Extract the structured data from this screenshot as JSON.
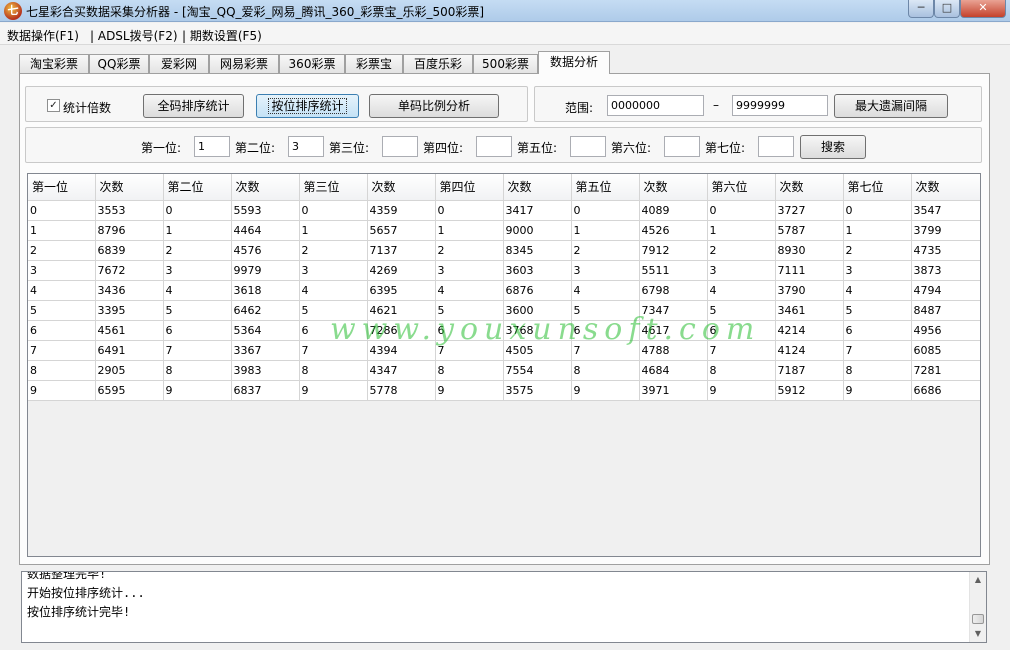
{
  "window": {
    "title": "七星彩合买数据采集分析器 - [淘宝_QQ_爱彩_网易_腾讯_360_彩票宝_乐彩_500彩票]",
    "min_glyph": "─",
    "max_glyph": "□",
    "close_glyph": "✕"
  },
  "menu": [
    {
      "label": "数据操作(F1)"
    },
    {
      "label": "| ADSL拨号(F2)"
    },
    {
      "label": "| 期数设置(F5)"
    }
  ],
  "tabs": [
    {
      "label": "淘宝彩票"
    },
    {
      "label": "QQ彩票"
    },
    {
      "label": "爱彩网"
    },
    {
      "label": "网易彩票"
    },
    {
      "label": "360彩票"
    },
    {
      "label": "彩票宝"
    },
    {
      "label": "百度乐彩"
    },
    {
      "label": "500彩票"
    },
    {
      "label": "数据分析",
      "active": true
    }
  ],
  "toolbar": {
    "checkbox_label": "统计倍数",
    "checkbox_checked": true,
    "btn_full_sort": "全码排序统计",
    "btn_position_sort": "按位排序统计",
    "btn_ratio": "单码比例分析",
    "range_label": "范围:",
    "range_from": "0000000",
    "range_dash": "–",
    "range_to": "9999999",
    "btn_max_gap": "最大遗漏间隔"
  },
  "search": {
    "labels": [
      "第一位:",
      "第二位:",
      "第三位:",
      "第四位:",
      "第五位:",
      "第六位:",
      "第七位:"
    ],
    "values": [
      "1",
      "3",
      "",
      "",
      "",
      "",
      ""
    ],
    "button": "搜索"
  },
  "grid": {
    "headers": [
      "第一位",
      "次数",
      "第二位",
      "次数",
      "第三位",
      "次数",
      "第四位",
      "次数",
      "第五位",
      "次数",
      "第六位",
      "次数",
      "第七位",
      "次数"
    ],
    "rows": [
      [
        "0",
        "3553",
        "0",
        "5593",
        "0",
        "4359",
        "0",
        "3417",
        "0",
        "4089",
        "0",
        "3727",
        "0",
        "3547"
      ],
      [
        "1",
        "8796",
        "1",
        "4464",
        "1",
        "5657",
        "1",
        "9000",
        "1",
        "4526",
        "1",
        "5787",
        "1",
        "3799"
      ],
      [
        "2",
        "6839",
        "2",
        "4576",
        "2",
        "7137",
        "2",
        "8345",
        "2",
        "7912",
        "2",
        "8930",
        "2",
        "4735"
      ],
      [
        "3",
        "7672",
        "3",
        "9979",
        "3",
        "4269",
        "3",
        "3603",
        "3",
        "5511",
        "3",
        "7111",
        "3",
        "3873"
      ],
      [
        "4",
        "3436",
        "4",
        "3618",
        "4",
        "6395",
        "4",
        "6876",
        "4",
        "6798",
        "4",
        "3790",
        "4",
        "4794"
      ],
      [
        "5",
        "3395",
        "5",
        "6462",
        "5",
        "4621",
        "5",
        "3600",
        "5",
        "7347",
        "5",
        "3461",
        "5",
        "8487"
      ],
      [
        "6",
        "4561",
        "6",
        "5364",
        "6",
        "7286",
        "6",
        "3768",
        "6",
        "4617",
        "6",
        "4214",
        "6",
        "4956"
      ],
      [
        "7",
        "6491",
        "7",
        "3367",
        "7",
        "4394",
        "7",
        "4505",
        "7",
        "4788",
        "7",
        "4124",
        "7",
        "6085"
      ],
      [
        "8",
        "2905",
        "8",
        "3983",
        "8",
        "4347",
        "8",
        "7554",
        "8",
        "4684",
        "8",
        "7187",
        "8",
        "7281"
      ],
      [
        "9",
        "6595",
        "9",
        "6837",
        "9",
        "5778",
        "9",
        "3575",
        "9",
        "3971",
        "9",
        "5912",
        "9",
        "6686"
      ]
    ]
  },
  "watermark": "www.youxunsoft.com",
  "log": {
    "lines": [
      "数据整理完毕!",
      "开始按位排序统计...",
      "按位排序统计完毕!"
    ]
  }
}
